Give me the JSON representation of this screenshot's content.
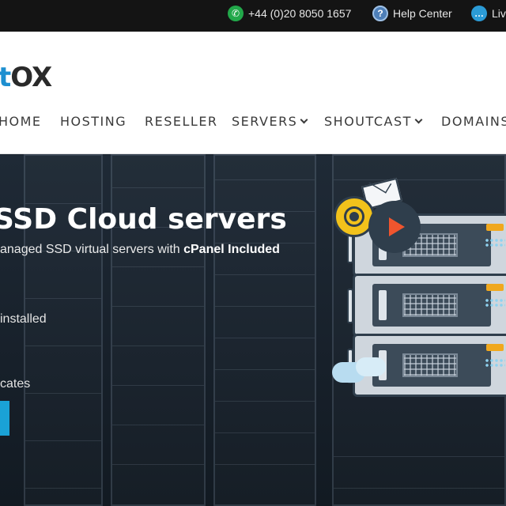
{
  "topbar": {
    "phone": "+44 (0)20 8050 1657",
    "help": "Help Center",
    "live": "Liv"
  },
  "brand": {
    "logo_accent": "t",
    "logo_main": "OX"
  },
  "nav": {
    "items": [
      "HOME",
      "HOSTING",
      "RESELLER",
      "SERVERS",
      "SHOUTCAST",
      "DOMAINS"
    ]
  },
  "hero": {
    "title": "SSD Cloud servers",
    "subtitle_prefix": "anaged SSD virtual servers with ",
    "subtitle_bold": "cPanel Included",
    "feature_1": "installed",
    "feature_2": "cates"
  },
  "colors": {
    "accent": "#1d8fd0",
    "topbar_bg": "#141414",
    "hero_bg": "#1b2530",
    "button": "#1aa2d6"
  },
  "icons": {
    "phone": "phone-icon",
    "help": "help-icon",
    "chat": "chat-icon"
  }
}
